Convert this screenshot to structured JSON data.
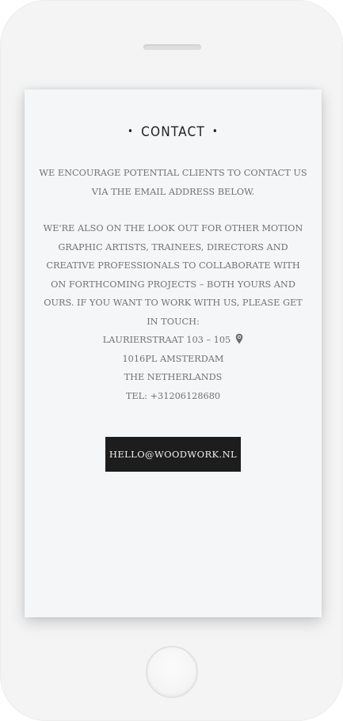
{
  "contact": {
    "title": "CONTACT",
    "title_dot": "•",
    "paragraph_1": "WE ENCOURAGE POTENTIAL CLIENTS TO CONTACT US VIA THE EMAIL ADDRESS BELOW.",
    "paragraph_2": "WE'RE ALSO ON THE LOOK OUT FOR OTHER MOTION GRAPHIC ARTISTS, TRAINEES, DIRECTORS AND CREATIVE PROFESSIONALS TO COLLABORATE WITH ON FORTHCOMING PROJECTS – BOTH YOURS AND OURS. IF YOU WANT TO WORK WITH US, PLEASE GET IN TOUCH:",
    "address": {
      "street": "LAURIERSTRAAT 103 – 105",
      "postcode_city": "1016PL AMSTERDAM",
      "country": "THE NETHERLANDS",
      "phone": "TEL: +31206128680",
      "icon": "map-pin-icon"
    },
    "email_button_label": "HELLO@WOODWORK.NL"
  },
  "colors": {
    "screen_background": "#f5f6f8",
    "body_text": "#727272",
    "heading_text": "#1f1f1f",
    "button_background": "#1d1d1d",
    "button_text": "#f1f1f1"
  }
}
